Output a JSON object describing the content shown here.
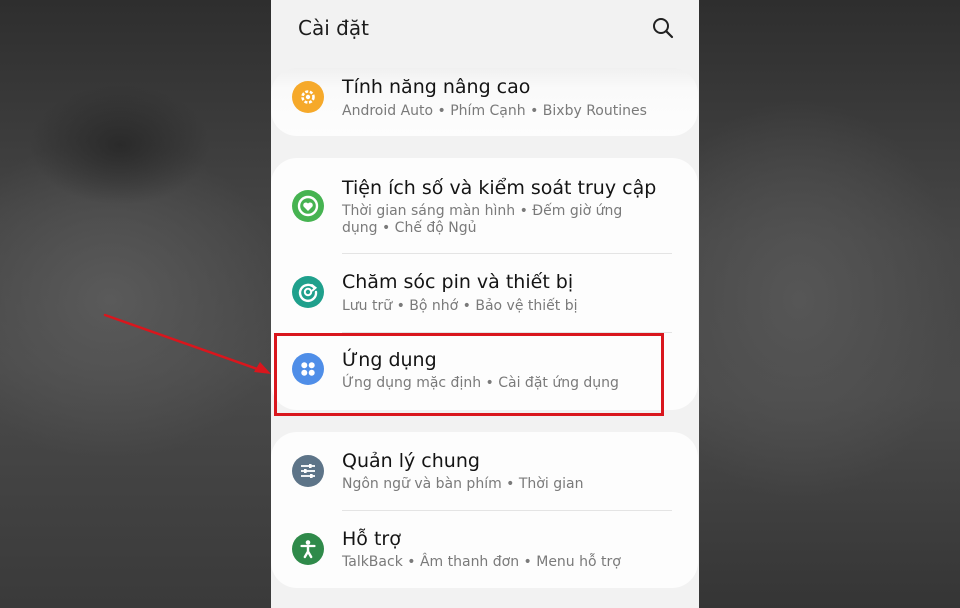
{
  "header": {
    "title": "Cài đặt",
    "search_icon": "search-icon"
  },
  "items": {
    "advanced": {
      "title": "Tính năng nâng cao",
      "subtitle": "Android Auto  •  Phím Cạnh  •  Bixby Routines",
      "icon": "gear-plus-icon",
      "color": "#f6a92a"
    },
    "wellbeing": {
      "title": "Tiện ích số và kiểm soát truy cập",
      "subtitle": "Thời gian sáng màn hình  •  Đếm giờ ứng dụng  •  Chế độ Ngủ",
      "icon": "heart-ring-icon",
      "color": "#46b351"
    },
    "battery": {
      "title": "Chăm sóc pin và thiết bị",
      "subtitle": "Lưu trữ  •  Bộ nhớ  •  Bảo vệ thiết bị",
      "icon": "device-care-icon",
      "color": "#1fa08c"
    },
    "apps": {
      "title": "Ứng dụng",
      "subtitle": "Ứng dụng mặc định  •  Cài đặt ứng dụng",
      "icon": "apps-grid-icon",
      "color": "#4f8ee8"
    },
    "general": {
      "title": "Quản lý chung",
      "subtitle": "Ngôn ngữ và bàn phím  •  Thời gian",
      "icon": "sliders-icon",
      "color": "#5d7488"
    },
    "accessibility": {
      "title": "Hỗ trợ",
      "subtitle": "TalkBack  •  Âm thanh đơn  •  Menu hỗ trợ",
      "icon": "accessibility-icon",
      "color": "#2f8a4a"
    }
  },
  "annotation": {
    "highlight_color": "#d9161d"
  }
}
